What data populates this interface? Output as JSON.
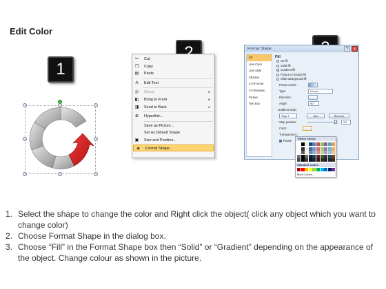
{
  "page_title": "Edit Color",
  "badges": [
    "1",
    "2",
    "3"
  ],
  "context_menu": {
    "items": [
      {
        "label": "Cut",
        "icon": "scissors-icon",
        "glyph": "✂",
        "disabled": false,
        "submenu": false,
        "highlight": false
      },
      {
        "label": "Copy",
        "icon": "copy-icon",
        "glyph": "❐",
        "disabled": false,
        "submenu": false,
        "highlight": false
      },
      {
        "label": "Paste",
        "icon": "paste-icon",
        "glyph": "▤",
        "disabled": false,
        "submenu": false,
        "highlight": false,
        "sep_after": true
      },
      {
        "label": "Edit Text",
        "icon": "edit-text-icon",
        "glyph": "A",
        "disabled": false,
        "submenu": false,
        "highlight": false,
        "sep_after": true
      },
      {
        "label": "Group",
        "icon": "group-icon",
        "glyph": "▦",
        "disabled": true,
        "submenu": true,
        "highlight": false
      },
      {
        "label": "Bring to Front",
        "icon": "bring-front-icon",
        "glyph": "◧",
        "disabled": false,
        "submenu": true,
        "highlight": false
      },
      {
        "label": "Send to Back",
        "icon": "send-back-icon",
        "glyph": "◨",
        "disabled": false,
        "submenu": true,
        "highlight": false,
        "sep_after": true
      },
      {
        "label": "Hyperlink...",
        "icon": "hyperlink-icon",
        "glyph": "⊕",
        "disabled": false,
        "submenu": false,
        "highlight": false,
        "sep_after": true
      },
      {
        "label": "Save as Picture...",
        "icon": "",
        "glyph": "",
        "disabled": false,
        "submenu": false,
        "highlight": false
      },
      {
        "label": "Set as Default Shape",
        "icon": "",
        "glyph": "",
        "disabled": false,
        "submenu": false,
        "highlight": false
      },
      {
        "label": "Size and Position...",
        "icon": "size-icon",
        "glyph": "▣",
        "disabled": false,
        "submenu": false,
        "highlight": false
      },
      {
        "label": "Format Shape...",
        "icon": "format-shape-icon",
        "glyph": "◈",
        "disabled": false,
        "submenu": false,
        "highlight": true
      }
    ]
  },
  "dialog": {
    "title": "Format Shape",
    "help": "?",
    "close": "X",
    "left_items": [
      {
        "label": "Fill",
        "selected": true
      },
      {
        "label": "Line Color",
        "selected": false
      },
      {
        "label": "Line Style",
        "selected": false
      },
      {
        "label": "Shadow",
        "selected": false
      },
      {
        "label": "3-D Format",
        "selected": false
      },
      {
        "label": "3-D Rotation",
        "selected": false
      },
      {
        "label": "Picture",
        "selected": false
      },
      {
        "label": "Text Box",
        "selected": false
      }
    ],
    "fill_header": "Fill",
    "fill_options": [
      {
        "label": "No fill",
        "on": false
      },
      {
        "label": "Solid fill",
        "on": false
      },
      {
        "label": "Gradient fill",
        "on": true
      },
      {
        "label": "Picture or texture fill",
        "on": false
      },
      {
        "label": "Slide background fill",
        "on": false
      }
    ],
    "preset_colors_label": "Preset colors:",
    "type_label": "Type:",
    "type_value": "Linear",
    "direction_label": "Direction:",
    "angle_label": "Angle:",
    "angle_value": "90°",
    "gradient_stops_label": "Gradient stops",
    "stop_value": "Stop 1",
    "add_label": "Add",
    "remove_label": "Remove",
    "stop_position_label": "Stop position:",
    "stop_position_value": "0%",
    "color_label": "Color:",
    "transparency_label": "Transparency:",
    "rotate_label": "Rotate"
  },
  "palette": {
    "theme_header": "Theme Colors",
    "standard_header": "Standard Colors",
    "more_colors": "More Colors..."
  },
  "colors": {
    "accent_red": "#d21f1f",
    "ring_gray": "#a9a9a9",
    "highlight": "#fbd574",
    "dialog_border": "#7d9ec3"
  },
  "instructions": [
    {
      "num": "1.",
      "text": "Select the shape to change the color and Right click the object( click any object which you want to change color)"
    },
    {
      "num": "2.",
      "text": "Choose Format Shape in the dialog box."
    },
    {
      "num": "3.",
      "text": "Choose “Fill” in the Format Shape box then “Solid” or “Gradient” depending on the appearance of the object. Change colour as shown in the picture."
    }
  ]
}
